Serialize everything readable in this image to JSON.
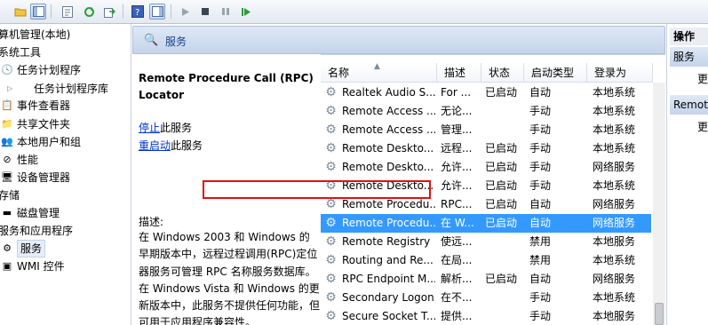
{
  "toolbar": {
    "icons": [
      "folder-up-icon",
      "show-hide-tree-icon",
      "properties-icon",
      "refresh-icon",
      "export-icon",
      "help-icon",
      "show-action-pane-icon",
      "play-icon",
      "stop-icon",
      "pause-icon",
      "resume-icon"
    ]
  },
  "tree": {
    "items": [
      {
        "label": "算机管理(本地)"
      },
      {
        "label": "系统工具"
      },
      {
        "label": "任务计划程序"
      },
      {
        "label": "任务计划程序库"
      },
      {
        "label": "事件查看器"
      },
      {
        "label": "共享文件夹"
      },
      {
        "label": "本地用户和组"
      },
      {
        "label": "性能"
      },
      {
        "label": "设备管理器"
      },
      {
        "label": "存储"
      },
      {
        "label": "磁盘管理"
      },
      {
        "label": "服务和应用程序"
      },
      {
        "label": "服务"
      },
      {
        "label": "WMI 控件"
      }
    ]
  },
  "header": {
    "title": "服务"
  },
  "description": {
    "service_name": "Remote Procedure Call (RPC) Locator",
    "stop_link": "停止",
    "stop_suffix": "此服务",
    "restart_link": "重启动",
    "restart_suffix": "此服务",
    "label": "描述:",
    "text": "在 Windows 2003 和 Windows 的早期版本中，远程过程调用(RPC)定位器服务可管理 RPC 名称服务数据库。\n在 Windows Vista 和 Windows 的更新版本中，此服务不提供任何功能，但可用于应用程序兼容性。"
  },
  "table": {
    "columns": [
      "名称",
      "描述",
      "状态",
      "启动类型",
      "登录为"
    ],
    "rows": [
      {
        "name": "Realtek Audio S...",
        "desc": "For ...",
        "status": "已启动",
        "startup": "自动",
        "logon": "本地系统"
      },
      {
        "name": "Remote Access ...",
        "desc": "无论...",
        "status": "",
        "startup": "手动",
        "logon": "本地系统"
      },
      {
        "name": "Remote Access ...",
        "desc": "管理...",
        "status": "",
        "startup": "手动",
        "logon": "本地系统"
      },
      {
        "name": "Remote Deskto...",
        "desc": "远程...",
        "status": "已启动",
        "startup": "手动",
        "logon": "本地系统"
      },
      {
        "name": "Remote Deskto...",
        "desc": "允许...",
        "status": "已启动",
        "startup": "手动",
        "logon": "网络服务"
      },
      {
        "name": "Remote Deskto...",
        "desc": "允许...",
        "status": "已启动",
        "startup": "手动",
        "logon": "本地系统"
      },
      {
        "name": "Remote Procedu...",
        "desc": "RPC...",
        "status": "已启动",
        "startup": "自动",
        "logon": "网络服务"
      },
      {
        "name": "Remote Procedu...",
        "desc": "在 W...",
        "status": "已启动",
        "startup": "自动",
        "logon": "网络服务"
      },
      {
        "name": "Remote Registry",
        "desc": "使远...",
        "status": "",
        "startup": "禁用",
        "logon": "本地服务"
      },
      {
        "name": "Routing and Re...",
        "desc": "在局...",
        "status": "",
        "startup": "禁用",
        "logon": "本地系统"
      },
      {
        "name": "RPC Endpoint M...",
        "desc": "解析...",
        "status": "已启动",
        "startup": "自动",
        "logon": "网络服务"
      },
      {
        "name": "Secondary Logon",
        "desc": "在不...",
        "status": "",
        "startup": "手动",
        "logon": "本地系统"
      },
      {
        "name": "Secure Socket T...",
        "desc": "提供...",
        "status": "",
        "startup": "手动",
        "logon": "本地服务"
      }
    ]
  },
  "actions": {
    "header": "操作",
    "section1": "服务",
    "more1": "更",
    "section2": "Remot",
    "more2": "更"
  }
}
